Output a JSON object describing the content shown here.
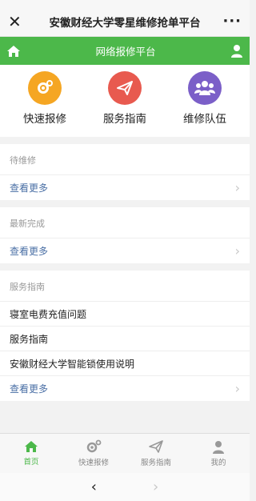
{
  "titlebar": {
    "close_glyph": "✕",
    "title": "安徽财经大学零星维修抢单平台",
    "more_glyph": "···"
  },
  "greenbar": {
    "title": "网络报修平台",
    "left_icon": "home-icon",
    "right_icon": "user-icon"
  },
  "quick": [
    {
      "label": "快速报修",
      "icon": "gear-icon",
      "color": "#f5a623"
    },
    {
      "label": "服务指南",
      "icon": "paper-plane-icon",
      "color": "#e85a4f"
    },
    {
      "label": "维修队伍",
      "icon": "team-icon",
      "color": "#7b5fc8"
    }
  ],
  "pending": {
    "header": "待维修",
    "more": "查看更多"
  },
  "completed": {
    "header": "最新完成",
    "more": "查看更多"
  },
  "guide": {
    "header": "服务指南",
    "items": [
      "寝室电费充值问题",
      "服务指南",
      "安徽财经大学智能锁使用说明"
    ],
    "more": "查看更多"
  },
  "tabs": [
    {
      "label": "首页",
      "icon": "home-icon"
    },
    {
      "label": "快速报修",
      "icon": "gear-icon"
    },
    {
      "label": "服务指南",
      "icon": "paper-plane-icon"
    },
    {
      "label": "我的",
      "icon": "user-icon"
    }
  ],
  "colors": {
    "accent": "#4cb84a",
    "link": "#4a6fa5"
  },
  "navbar": {
    "back": "‹",
    "forward": "›"
  },
  "chevron": "›"
}
